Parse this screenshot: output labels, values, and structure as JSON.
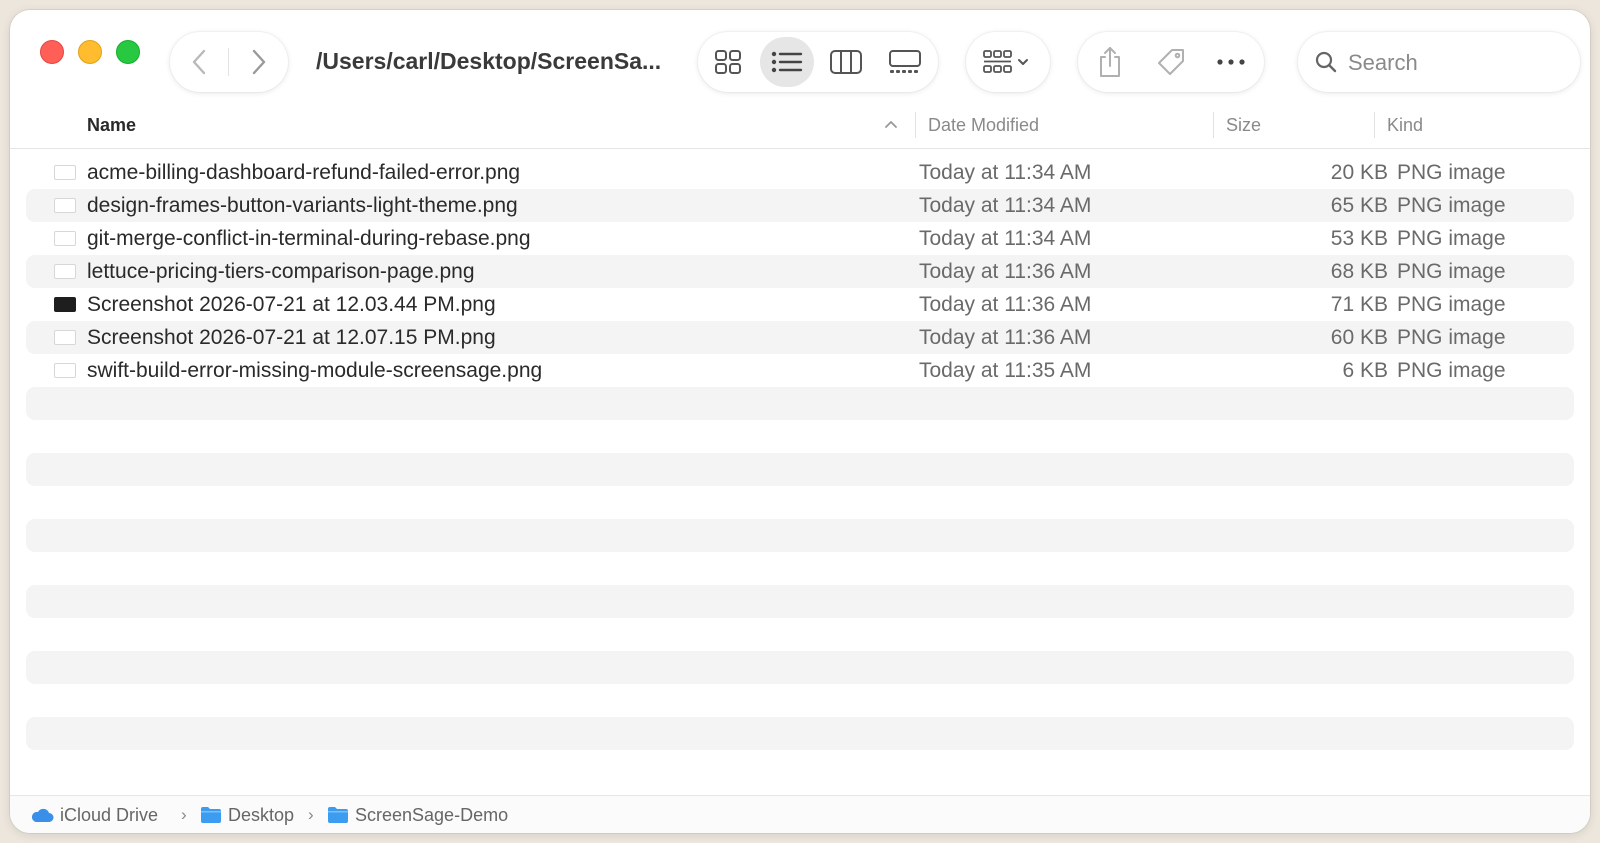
{
  "window": {
    "path_title": "/Users/carl/Desktop/ScreenSa..."
  },
  "toolbar": {
    "nav": [
      {
        "name": "back",
        "icon": "chevron-left-icon"
      },
      {
        "name": "forward",
        "icon": "chevron-right-icon"
      }
    ],
    "view_modes": [
      {
        "name": "icons",
        "icon": "grid-icon",
        "selected": false
      },
      {
        "name": "list",
        "icon": "list-icon",
        "selected": true
      },
      {
        "name": "columns",
        "icon": "columns-icon",
        "selected": false
      },
      {
        "name": "gallery",
        "icon": "gallery-icon",
        "selected": false
      }
    ],
    "group_icon": "group-by-icon",
    "actions": [
      {
        "name": "share",
        "icon": "share-icon"
      },
      {
        "name": "tag",
        "icon": "tag-icon"
      },
      {
        "name": "more",
        "icon": "ellipsis-icon"
      }
    ],
    "search": {
      "placeholder": "Search",
      "value": ""
    }
  },
  "columns": {
    "name": "Name",
    "date": "Date Modified",
    "size": "Size",
    "kind": "Kind",
    "sorted_by": "name",
    "sort_direction": "ascending"
  },
  "files": [
    {
      "name": "acme-billing-dashboard-refund-failed-error.png",
      "date": "Today at 11:34 AM",
      "size": "20 KB",
      "kind": "PNG image",
      "thumb": "light"
    },
    {
      "name": "design-frames-button-variants-light-theme.png",
      "date": "Today at 11:34 AM",
      "size": "65 KB",
      "kind": "PNG image",
      "thumb": "light"
    },
    {
      "name": "git-merge-conflict-in-terminal-during-rebase.png",
      "date": "Today at 11:34 AM",
      "size": "53 KB",
      "kind": "PNG image",
      "thumb": "light"
    },
    {
      "name": "lettuce-pricing-tiers-comparison-page.png",
      "date": "Today at 11:36 AM",
      "size": "68 KB",
      "kind": "PNG image",
      "thumb": "light"
    },
    {
      "name": "Screenshot 2026-07-21 at 12.03.44 PM.png",
      "date": "Today at 11:36 AM",
      "size": "71 KB",
      "kind": "PNG image",
      "thumb": "dark"
    },
    {
      "name": "Screenshot 2026-07-21 at 12.07.15 PM.png",
      "date": "Today at 11:36 AM",
      "size": "60 KB",
      "kind": "PNG image",
      "thumb": "light"
    },
    {
      "name": "swift-build-error-missing-module-screensage.png",
      "date": "Today at 11:35 AM",
      "size": "6 KB",
      "kind": "PNG image",
      "thumb": "light"
    }
  ],
  "empty_rows": 12,
  "pathbar": {
    "crumbs": [
      {
        "label": "iCloud Drive",
        "icon": "icloud-icon"
      },
      {
        "label": "Desktop",
        "icon": "folder-icon"
      },
      {
        "label": "ScreenSage-Demo",
        "icon": "folder-icon"
      }
    ]
  },
  "colors": {
    "close": "#ff5f57",
    "minimize": "#febc2e",
    "zoom": "#28c840",
    "folder": "#3b9cf0",
    "icloud": "#3a8fe8",
    "row_stripe": "#f4f4f4"
  }
}
